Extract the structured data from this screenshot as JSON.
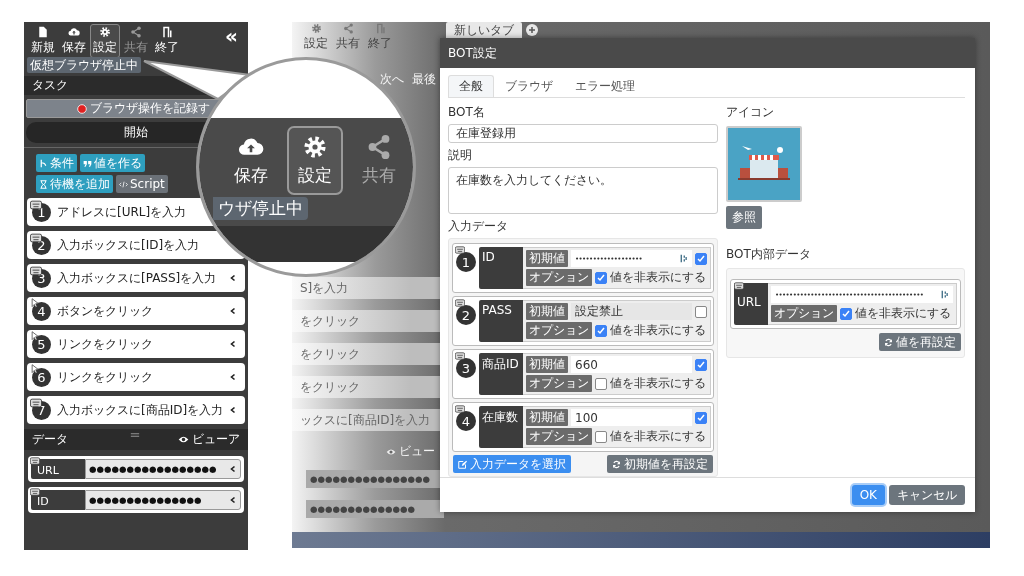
{
  "left_panel": {
    "toolbar": [
      {
        "label": "新規",
        "selected": false,
        "disabled": false
      },
      {
        "label": "保存",
        "selected": false,
        "disabled": false
      },
      {
        "label": "設定",
        "selected": true,
        "disabled": false
      },
      {
        "label": "共有",
        "selected": false,
        "disabled": true
      },
      {
        "label": "終了",
        "selected": false,
        "disabled": false
      }
    ],
    "collapse": "«",
    "status_badge": "仮想ブラウザ停止中",
    "task_header": "タスク",
    "record_button": "ブラウザ操作を記録す",
    "start_button": "開始",
    "actions": [
      {
        "label": "条件",
        "kind": "condition"
      },
      {
        "label": "値を作る",
        "kind": "value"
      },
      {
        "label": "待機を追加",
        "kind": "wait"
      },
      {
        "label": "Script",
        "kind": "script"
      }
    ],
    "steps": [
      {
        "number": "1",
        "label": "アドレスに[URL]を入力",
        "kind": "keyboard"
      },
      {
        "number": "2",
        "label": "入力ボックスに[ID]を入力",
        "kind": "keyboard"
      },
      {
        "number": "3",
        "label": "入力ボックスに[PASS]を入力",
        "kind": "keyboard"
      },
      {
        "number": "4",
        "label": "ボタンをクリック",
        "kind": "cursor"
      },
      {
        "number": "5",
        "label": "リンクをクリック",
        "kind": "cursor"
      },
      {
        "number": "6",
        "label": "リンクをクリック",
        "kind": "cursor"
      },
      {
        "number": "7",
        "label": "入力ボックスに[商品ID]を入力",
        "kind": "keyboard"
      }
    ],
    "data_header": "データ",
    "viewer": "ビューア",
    "data_rows": [
      {
        "name": "URL",
        "value": "●●●●●●●●●●●●●●●●●"
      },
      {
        "name": "ID",
        "value": "●●●●●●●●●●●●●●●"
      }
    ]
  },
  "lens": {
    "items": [
      {
        "label": "保存",
        "selected": false,
        "disabled": false
      },
      {
        "label": "設定",
        "selected": true,
        "disabled": false
      },
      {
        "label": "共有",
        "selected": false,
        "disabled": true
      }
    ],
    "badge": "ウザ停止中"
  },
  "background_window": {
    "toolbar": [
      "設定",
      "共有",
      "終了"
    ],
    "tab": "新しいタブ",
    "nav": [
      "次へ",
      "最後"
    ],
    "rows": [
      "S]を入力",
      "をクリック",
      "をクリック",
      "をクリック",
      "ックスに[商品ID]を入力"
    ],
    "viewer": "ビュー",
    "data_values": [
      "●●●●●●●●●●●●●●●●",
      "●●●●●●●●●●●●●●"
    ]
  },
  "dialog": {
    "title": "BOT設定",
    "tabs": [
      {
        "label": "全般",
        "selected": true
      },
      {
        "label": "ブラウザ",
        "selected": false
      },
      {
        "label": "エラー処理",
        "selected": false
      }
    ],
    "name_label": "BOT名",
    "name_value": "在庫登録用",
    "description_label": "説明",
    "description_value": "在庫数を入力してください。",
    "input_data_label": "入力データ",
    "input_data": [
      {
        "number": "1",
        "name": "ID",
        "kind": "secret",
        "initial_label": "初期値",
        "initial_value": "•••••••••••••••••••",
        "disabled": false,
        "use_initial": true,
        "option_label": "オプション",
        "hide_label": "値を非表示にする",
        "hide_value": true
      },
      {
        "number": "2",
        "name": "PASS",
        "kind": "text",
        "initial_label": "初期値",
        "initial_value": "設定禁止",
        "disabled": true,
        "use_initial": false,
        "option_label": "オプション",
        "hide_label": "値を非表示にする",
        "hide_value": true
      },
      {
        "number": "3",
        "name": "商品ID",
        "kind": "text",
        "initial_label": "初期値",
        "initial_value": "660",
        "disabled": false,
        "use_initial": true,
        "option_label": "オプション",
        "hide_label": "値を非表示にする",
        "hide_value": false
      },
      {
        "number": "4",
        "name": "在庫数",
        "kind": "text",
        "initial_label": "初期値",
        "initial_value": "100",
        "disabled": false,
        "use_initial": true,
        "option_label": "オプション",
        "hide_label": "値を非表示にする",
        "hide_value": false
      }
    ],
    "select_button": "入力データを選択",
    "reset_initial_button": "初期値を再設定",
    "icon_label": "アイコン",
    "browse_button": "参照",
    "internal_label": "BOT内部データ",
    "internal_data": [
      {
        "name": "URL",
        "value": "••••••••••••••••••••••••••••••••••••••••••",
        "option_label": "オプション",
        "hide_label": "値を非表示にする",
        "hide_value": true
      }
    ],
    "reset_value_button": "値を再設定",
    "ok_button": "OK",
    "cancel_button": "キャンセル"
  }
}
